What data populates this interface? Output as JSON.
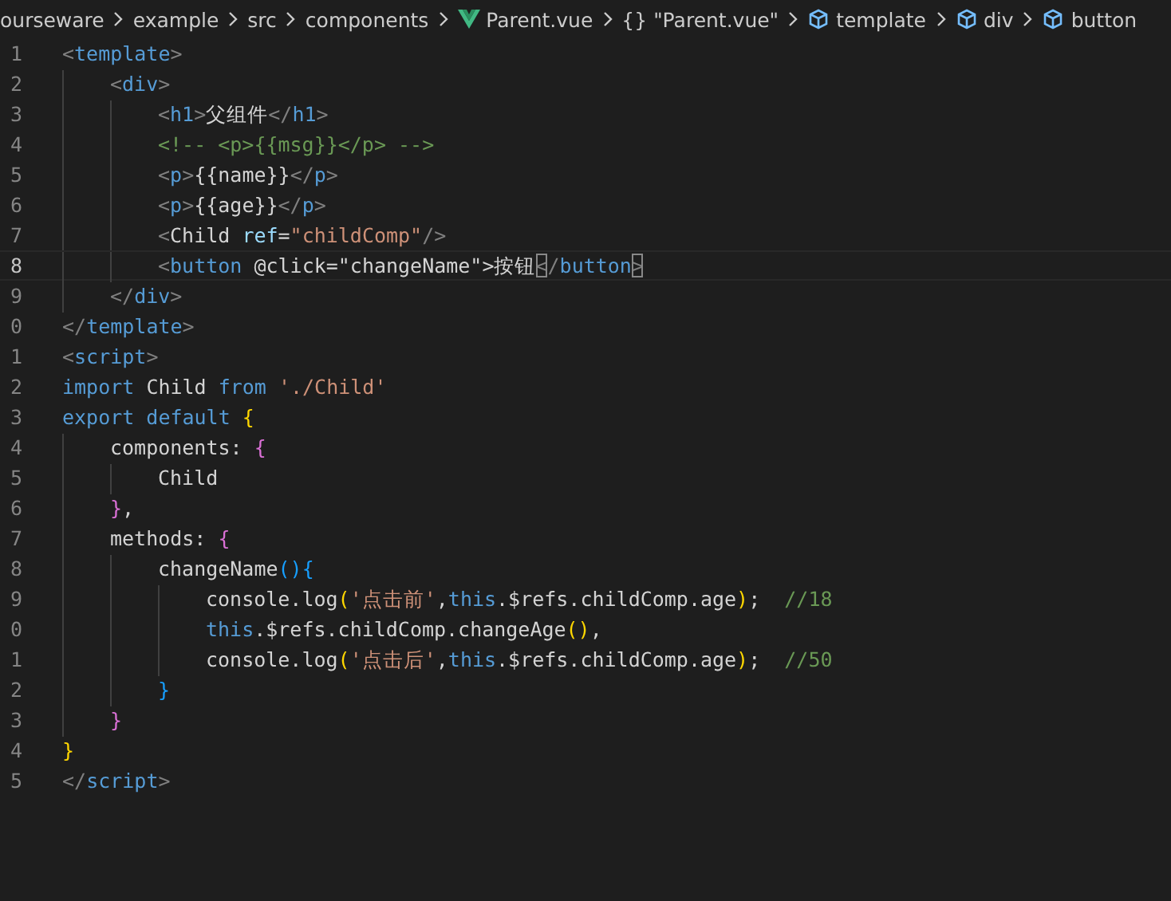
{
  "breadcrumb": [
    {
      "kind": "folder",
      "label": "ourseware"
    },
    {
      "kind": "folder",
      "label": "example"
    },
    {
      "kind": "folder",
      "label": "src"
    },
    {
      "kind": "folder",
      "label": "components"
    },
    {
      "kind": "vue",
      "label": "Parent.vue"
    },
    {
      "kind": "braces",
      "label": "\"Parent.vue\"",
      "glyph": "{}"
    },
    {
      "kind": "element",
      "label": "template"
    },
    {
      "kind": "element",
      "label": "div"
    },
    {
      "kind": "element",
      "label": "button"
    }
  ],
  "lines": [
    {
      "number": "1",
      "current": false,
      "tokens": [
        {
          "kind": "punct",
          "text": "<"
        },
        {
          "kind": "tag",
          "text": "template"
        },
        {
          "kind": "punct",
          "text": ">"
        }
      ],
      "children": [
        {
          "number": "2",
          "current": false,
          "tokens": [
            {
              "kind": "punct",
              "text": "<"
            },
            {
              "kind": "tag",
              "text": "div"
            },
            {
              "kind": "punct",
              "text": ">"
            }
          ],
          "children": [
            {
              "number": "3",
              "current": false,
              "tokens": [
                {
                  "kind": "punct",
                  "text": "<"
                },
                {
                  "kind": "tag",
                  "text": "h1"
                },
                {
                  "kind": "punct",
                  "text": ">"
                },
                {
                  "kind": "text",
                  "text": "父组件"
                },
                {
                  "kind": "punct",
                  "text": "</"
                },
                {
                  "kind": "tag",
                  "text": "h1"
                },
                {
                  "kind": "punct",
                  "text": ">"
                }
              ]
            },
            {
              "number": "4",
              "current": false,
              "tokens": [
                {
                  "kind": "comment",
                  "text": "<!-- <p>{{msg}}</p> -->"
                }
              ]
            },
            {
              "number": "5",
              "current": false,
              "tokens": [
                {
                  "kind": "punct",
                  "text": "<"
                },
                {
                  "kind": "tag",
                  "text": "p"
                },
                {
                  "kind": "punct",
                  "text": ">"
                },
                {
                  "kind": "text",
                  "text": "{{name}}"
                },
                {
                  "kind": "punct",
                  "text": "</"
                },
                {
                  "kind": "tag",
                  "text": "p"
                },
                {
                  "kind": "punct",
                  "text": ">"
                }
              ]
            },
            {
              "number": "6",
              "current": false,
              "tokens": [
                {
                  "kind": "punct",
                  "text": "<"
                },
                {
                  "kind": "tag",
                  "text": "p"
                },
                {
                  "kind": "punct",
                  "text": ">"
                },
                {
                  "kind": "text",
                  "text": "{{age}}"
                },
                {
                  "kind": "punct",
                  "text": "</"
                },
                {
                  "kind": "tag",
                  "text": "p"
                },
                {
                  "kind": "punct",
                  "text": ">"
                }
              ]
            },
            {
              "number": "7",
              "current": false,
              "tokens": [
                {
                  "kind": "punct",
                  "text": "<"
                },
                {
                  "kind": "text",
                  "text": "Child "
                },
                {
                  "kind": "attr",
                  "text": "ref"
                },
                {
                  "kind": "text",
                  "text": "="
                },
                {
                  "kind": "string",
                  "text": "\"childComp\""
                },
                {
                  "kind": "punct",
                  "text": "/>"
                }
              ]
            },
            {
              "number": "8",
              "current": true,
              "tokens": [
                {
                  "kind": "punct",
                  "text": "<"
                },
                {
                  "kind": "tag",
                  "text": "button "
                },
                {
                  "kind": "text",
                  "text": "@click=\"changeName\">按钮"
                },
                {
                  "kind": "punct",
                  "text": "<",
                  "matched": true
                },
                {
                  "kind": "punct",
                  "text": "/"
                },
                {
                  "kind": "tag",
                  "text": "button"
                },
                {
                  "kind": "punct",
                  "text": ">",
                  "matched": true
                }
              ]
            }
          ]
        },
        {
          "number": "9",
          "current": false,
          "tokens": [
            {
              "kind": "punct",
              "text": "</"
            },
            {
              "kind": "tag",
              "text": "div"
            },
            {
              "kind": "punct",
              "text": ">"
            }
          ]
        }
      ]
    },
    {
      "number": "0",
      "current": false,
      "tokens": [
        {
          "kind": "punct",
          "text": "</"
        },
        {
          "kind": "tag",
          "text": "template"
        },
        {
          "kind": "punct",
          "text": ">"
        }
      ]
    },
    {
      "number": "1",
      "current": false,
      "tokens": [
        {
          "kind": "punct",
          "text": "<"
        },
        {
          "kind": "tag",
          "text": "script"
        },
        {
          "kind": "punct",
          "text": ">"
        }
      ]
    },
    {
      "number": "2",
      "current": false,
      "tokens": [
        {
          "kind": "keyword",
          "text": "import "
        },
        {
          "kind": "text",
          "text": "Child "
        },
        {
          "kind": "keyword",
          "text": "from "
        },
        {
          "kind": "string",
          "text": "'./Child'"
        }
      ]
    },
    {
      "number": "3",
      "current": false,
      "tokens": [
        {
          "kind": "keyword",
          "text": "export default "
        },
        {
          "kind": "brace1",
          "text": "{"
        }
      ],
      "children": [
        {
          "number": "4",
          "current": false,
          "tokens": [
            {
              "kind": "text",
              "text": "components: "
            },
            {
              "kind": "brace2",
              "text": "{"
            }
          ],
          "children": [
            {
              "number": "5",
              "current": false,
              "tokens": [
                {
                  "kind": "text",
                  "text": "Child"
                }
              ]
            }
          ]
        },
        {
          "number": "6",
          "current": false,
          "tokens": [
            {
              "kind": "brace2",
              "text": "}"
            },
            {
              "kind": "text",
              "text": ","
            }
          ]
        },
        {
          "number": "7",
          "current": false,
          "tokens": [
            {
              "kind": "text",
              "text": "methods: "
            },
            {
              "kind": "brace2",
              "text": "{"
            }
          ],
          "children": [
            {
              "number": "8",
              "current": false,
              "tokens": [
                {
                  "kind": "text",
                  "text": "changeName"
                },
                {
                  "kind": "brace3",
                  "text": "(){"
                }
              ],
              "children": [
                {
                  "number": "9",
                  "current": false,
                  "tokens": [
                    {
                      "kind": "text",
                      "text": "console.log"
                    },
                    {
                      "kind": "brace1",
                      "text": "("
                    },
                    {
                      "kind": "string",
                      "text": "'点击前'"
                    },
                    {
                      "kind": "text",
                      "text": ","
                    },
                    {
                      "kind": "keyword",
                      "text": "this"
                    },
                    {
                      "kind": "text",
                      "text": ".$refs.childComp.age"
                    },
                    {
                      "kind": "brace1",
                      "text": ")"
                    },
                    {
                      "kind": "text",
                      "text": ";  "
                    },
                    {
                      "kind": "comment",
                      "text": "//18"
                    }
                  ]
                },
                {
                  "number": "0",
                  "current": false,
                  "tokens": [
                    {
                      "kind": "keyword",
                      "text": "this"
                    },
                    {
                      "kind": "text",
                      "text": ".$refs.childComp.changeAge"
                    },
                    {
                      "kind": "brace1",
                      "text": "()"
                    },
                    {
                      "kind": "text",
                      "text": ","
                    }
                  ]
                },
                {
                  "number": "1",
                  "current": false,
                  "tokens": [
                    {
                      "kind": "text",
                      "text": "console.log"
                    },
                    {
                      "kind": "brace1",
                      "text": "("
                    },
                    {
                      "kind": "string",
                      "text": "'点击后'"
                    },
                    {
                      "kind": "text",
                      "text": ","
                    },
                    {
                      "kind": "keyword",
                      "text": "this"
                    },
                    {
                      "kind": "text",
                      "text": ".$refs.childComp.age"
                    },
                    {
                      "kind": "brace1",
                      "text": ")"
                    },
                    {
                      "kind": "text",
                      "text": ";  "
                    },
                    {
                      "kind": "comment",
                      "text": "//50"
                    }
                  ]
                }
              ]
            },
            {
              "number": "2",
              "current": false,
              "tokens": [
                {
                  "kind": "brace3",
                  "text": "}"
                }
              ]
            }
          ]
        },
        {
          "number": "3",
          "current": false,
          "tokens": [
            {
              "kind": "brace2",
              "text": "}"
            }
          ]
        }
      ]
    },
    {
      "number": "4",
      "current": false,
      "tokens": [
        {
          "kind": "brace1",
          "text": "}"
        }
      ]
    },
    {
      "number": "5",
      "current": false,
      "tokens": [
        {
          "kind": "punct",
          "text": "</"
        },
        {
          "kind": "tag",
          "text": "script"
        },
        {
          "kind": "punct",
          "text": ">"
        }
      ]
    }
  ]
}
